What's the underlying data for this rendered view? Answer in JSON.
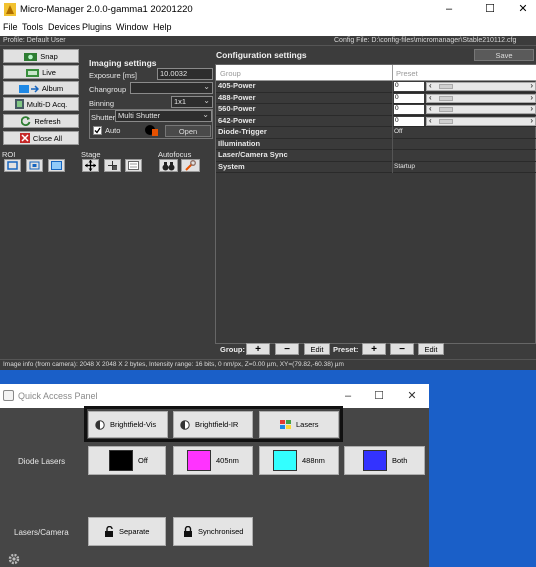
{
  "main": {
    "title": "Micro-Manager 2.0.0-gamma1 20201220",
    "menu": [
      "File",
      "Tools",
      "Devices",
      "Plugins",
      "Window",
      "Help"
    ],
    "profile": "Profile: Default User",
    "config_file": "Config File: D:\\config-files\\micromanager\\Stable210112.cfg",
    "buttons": {
      "snap": "Snap",
      "live": "Live",
      "album": "Album",
      "mda": "Multi-D Acq.",
      "refresh": "Refresh",
      "close_all": "Close All"
    },
    "imaging": {
      "heading": "Imaging settings",
      "exposure_label": "Exposure [ms]",
      "exposure_value": "10.0032",
      "changroup_label": "Changroup",
      "changroup_value": "",
      "binning_label": "Binning",
      "binning_value": "1x1",
      "shutter_label": "Shutter",
      "shutter_value": "Multi Shutter",
      "auto_label": "Auto",
      "auto_checked": true,
      "open_label": "Open"
    },
    "sections": {
      "roi": "ROI",
      "stage": "Stage",
      "autofocus": "Autofocus"
    },
    "config": {
      "heading": "Configuration settings",
      "save_label": "Save",
      "col_group": "Group",
      "col_preset": "Preset",
      "rows": [
        {
          "group": "405-Power",
          "preset": "0",
          "slider": true
        },
        {
          "group": "488-Power",
          "preset": "0",
          "slider": true
        },
        {
          "group": "560-Power",
          "preset": "0",
          "slider": true
        },
        {
          "group": "642-Power",
          "preset": "0",
          "slider": true
        },
        {
          "group": "Diode-Trigger",
          "preset": "Off",
          "slider": false
        },
        {
          "group": "Illumination",
          "preset": "",
          "slider": false
        },
        {
          "group": "Laser/Camera Sync",
          "preset": "",
          "slider": false
        },
        {
          "group": "System",
          "preset": "Startup",
          "slider": false
        }
      ],
      "group_label": "Group:",
      "preset_label": "Preset:",
      "plus": "+",
      "minus": "−",
      "edit": "Edit"
    },
    "status": "Image info (from camera): 2048 X 2048 X 2 bytes, Intensity range: 16 bits, 0 nm/px, Z=0.00 µm, XY=(79.82,-60.38) µm"
  },
  "qap": {
    "title": "Quick Access Panel",
    "top_buttons": [
      "Brightfield-Vis",
      "Brightfield-IR",
      "Lasers"
    ],
    "diode_label": "Diode Lasers",
    "diode_buttons": [
      {
        "label": "Off",
        "color": "#000000"
      },
      {
        "label": "405nm",
        "color": "#ff33ff"
      },
      {
        "label": "488nm",
        "color": "#33ffff"
      },
      {
        "label": "Both",
        "color": "#3333ff"
      }
    ],
    "sync_label": "Lasers/Camera",
    "sync_buttons": [
      "Separate",
      "Synchronised"
    ]
  },
  "colors": {
    "desktop": "#1a5fc8",
    "panel": "#3c3c3c"
  }
}
